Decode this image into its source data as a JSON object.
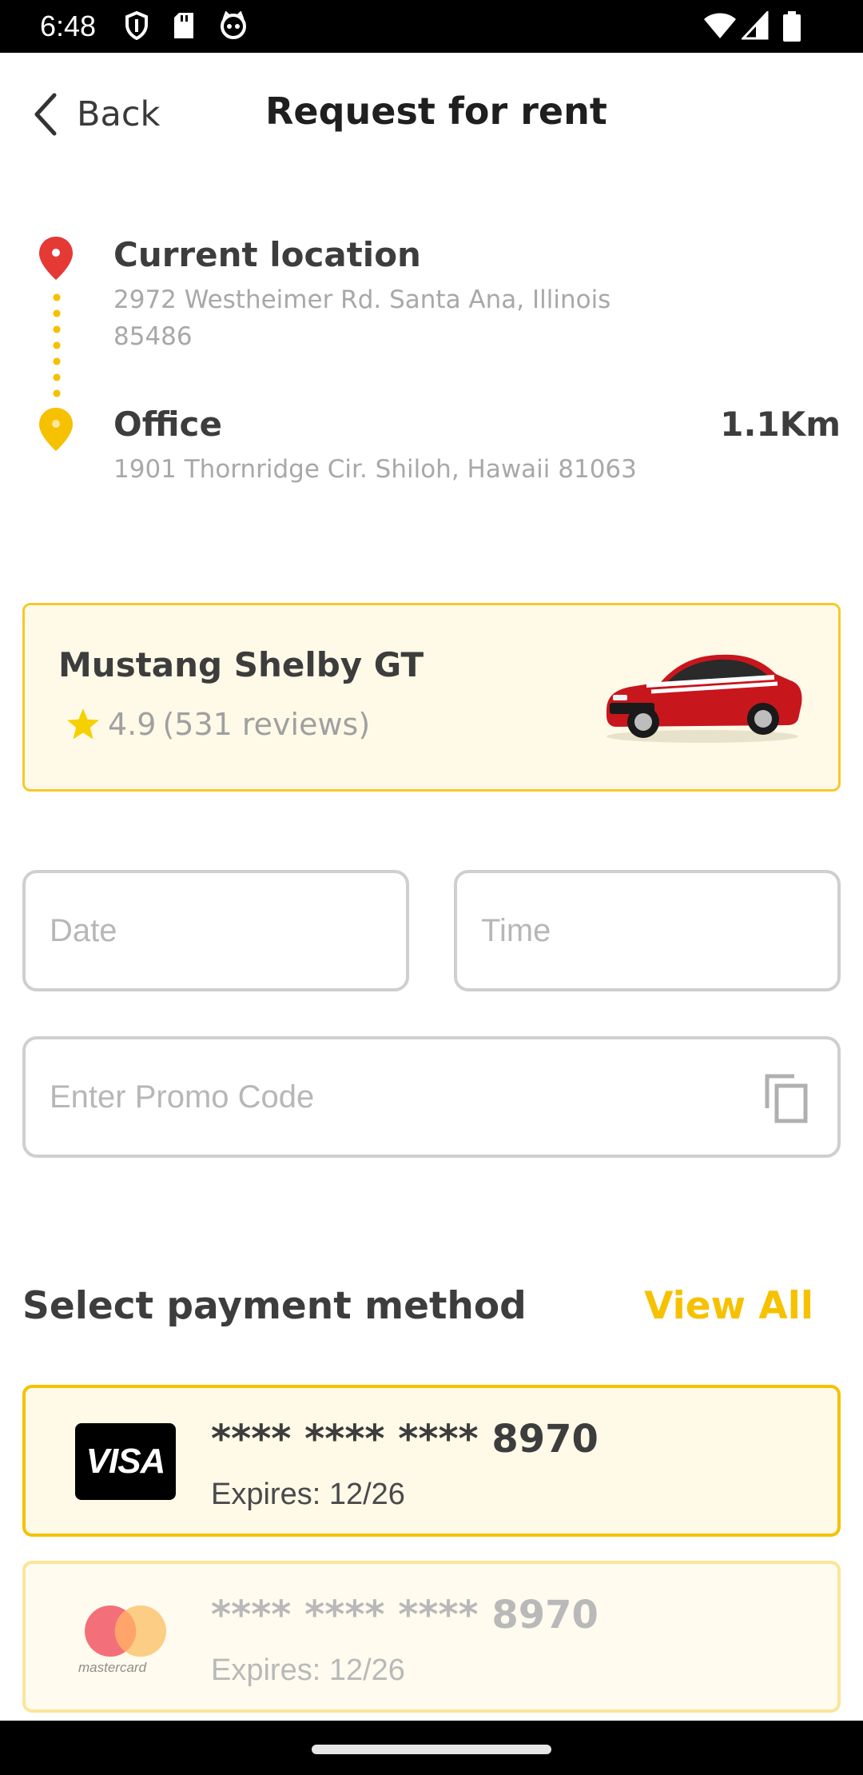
{
  "status_bar": {
    "time": "6:48"
  },
  "header": {
    "back_label": "Back",
    "title": "Request for rent"
  },
  "route": {
    "origin": {
      "title": "Current location",
      "address": "2972 Westheimer Rd. Santa Ana, Illinois 85486",
      "pin_color": "#e53935"
    },
    "destination": {
      "title": "Office",
      "address": "1901 Thornridge Cir. Shiloh, Hawaii 81063",
      "distance": "1.1Km",
      "pin_color": "#f6c100"
    }
  },
  "car": {
    "name": "Mustang Shelby GT",
    "rating": "4.9",
    "reviews": "(531 reviews)"
  },
  "form": {
    "date_placeholder": "Date",
    "time_placeholder": "Time",
    "promo_placeholder": "Enter Promo Code"
  },
  "payment": {
    "title": "Select payment method",
    "view_all": "View All",
    "cards": [
      {
        "brand": "VISA",
        "number": "**** **** **** 8970",
        "expiry": "Expires: 12/26",
        "selected": true
      },
      {
        "brand": "mastercard",
        "number": "**** **** **** 8970",
        "expiry": "Expires: 12/26",
        "selected": false
      }
    ]
  },
  "colors": {
    "accent": "#f6c100",
    "card_background": "#fffae8"
  }
}
